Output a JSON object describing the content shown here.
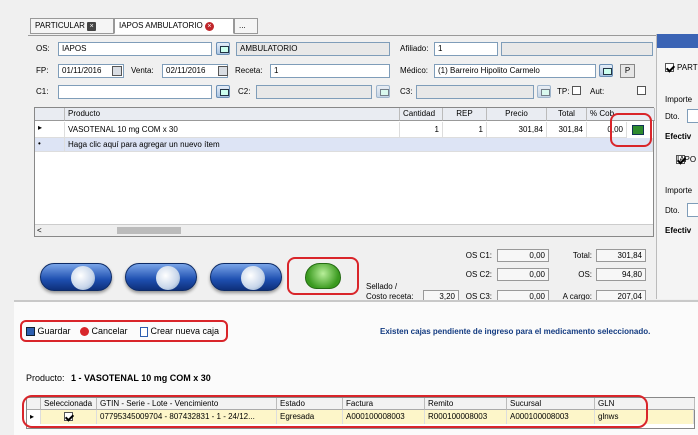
{
  "tabs": [
    {
      "label": "PARTICULAR"
    },
    {
      "label": "IAPOS AMBULATORIO"
    },
    {
      "label": "..."
    }
  ],
  "form": {
    "os_label": "OS:",
    "os_value": "IAPOS",
    "os_plan": "AMBULATORIO",
    "afiliado_label": "Afiliado:",
    "afiliado_value": "1",
    "fp_label": "FP:",
    "fp_value": "01/11/2016",
    "venta_label": "Venta:",
    "venta_value": "02/11/2016",
    "receta_label": "Receta:",
    "receta_value": "1",
    "medico_label": "Médico:",
    "medico_value": "(1) Barreiro Hipolito Carmelo",
    "medico_btn": "P",
    "c1_label": "C1:",
    "c2_label": "C2:",
    "c3_label": "C3:",
    "tp_label": "TP:",
    "aut_label": "Aut:"
  },
  "grid": {
    "columns": [
      "Producto",
      "Cantidad",
      "REP",
      "Precio",
      "Total",
      "% Cob"
    ],
    "rows": [
      {
        "marker": "▸",
        "producto": "VASOTENAL 10 mg COM x  30",
        "cantidad": "1",
        "rep": "1",
        "precio": "301,84",
        "total": "301,84",
        "cob": "0,00"
      }
    ],
    "new_row": "Haga clic aquí para agregar un nuevo ítem",
    "new_marker": "•"
  },
  "totals": {
    "os_c1_label": "OS C1:",
    "os_c1": "0,00",
    "os_c2_label": "OS C2:",
    "os_c2": "0,00",
    "os_c3_label": "OS C3:",
    "os_c3": "0,00",
    "total_label": "Total:",
    "total": "301,84",
    "os_label": "OS:",
    "os": "94,80",
    "a_cargo_label": "A cargo:",
    "a_cargo": "207,04",
    "sellado_label": "Sellado /",
    "costo_label": "Costo receta:",
    "costo": "3,20"
  },
  "right_panel": {
    "sections": [
      {
        "check_label": "PARTI",
        "importe": "Importe",
        "dto": "Dto.",
        "efectivo": "Efectiv"
      },
      {
        "check_label": "IAPO",
        "importe": "Importe",
        "dto": "Dto.",
        "efectivo": "Efectiv"
      }
    ]
  },
  "toolbar": {
    "guardar": "Guardar",
    "cancelar": "Cancelar",
    "nueva": "Crear nueva caja"
  },
  "notice": "Existen cajas pendiente de ingreso para el medicamento seleccionado.",
  "producto_label": "Producto:",
  "producto_value": "1 - VASOTENAL 10 mg COM x  30",
  "lower_grid": {
    "columns": [
      "Seleccionada",
      "GTIN - Serie - Lote - Vencimiento",
      "Estado",
      "Factura",
      "Remito",
      "Sucursal",
      "GLN"
    ],
    "row": {
      "gtin": "07795345009704 - 807432831 - 1 - 24/12...",
      "estado": "Egresada",
      "factura": "A000100008003",
      "remito": "R000100008003",
      "sucursal": "A000100008003",
      "gln": "glnws"
    }
  },
  "colors": {
    "accent": "#1e4fb0",
    "highlight": "#d9252a",
    "selected_row": "#fdf6c9"
  }
}
